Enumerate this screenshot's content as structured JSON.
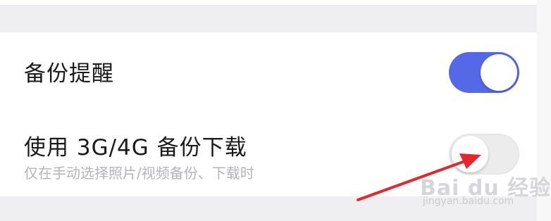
{
  "settings": {
    "backup_reminder": {
      "label": "备份提醒",
      "enabled": true
    },
    "cellular_backup": {
      "label": "使用 3G/4G 备份下载",
      "sublabel": "仅在手动选择照片/视频备份、下载时",
      "enabled": false
    }
  },
  "colors": {
    "toggle_on": "#5468e8",
    "toggle_off": "#ececec",
    "annotation_arrow": "#e8252b"
  },
  "watermark": {
    "logo": "Bai du 经验",
    "url": "jingyan.baidu.com"
  }
}
